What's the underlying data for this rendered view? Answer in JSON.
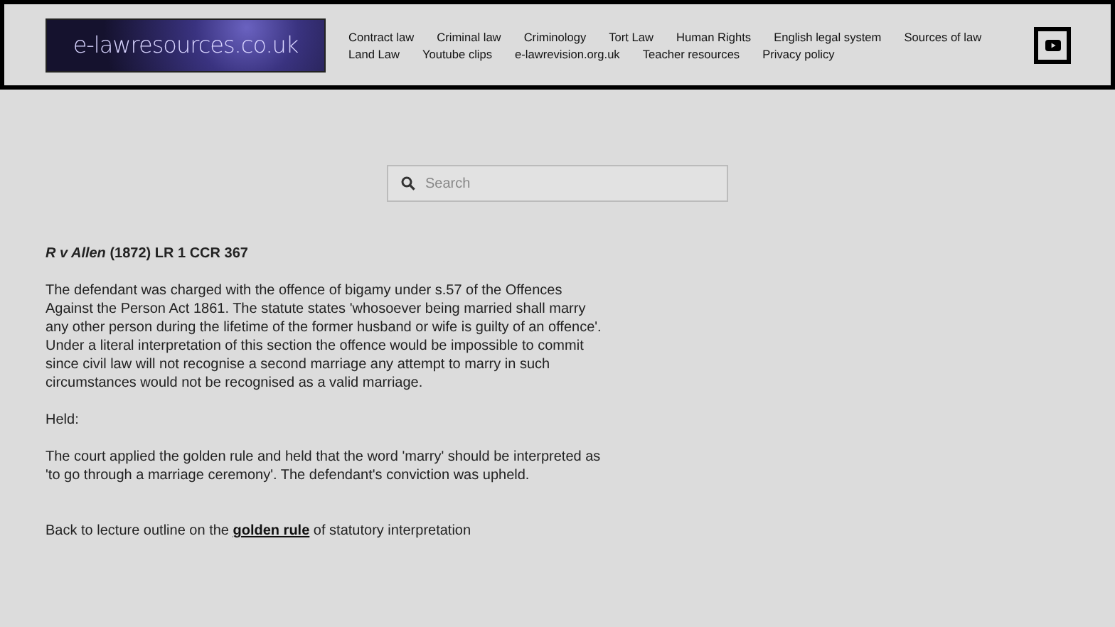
{
  "header": {
    "logo": "e-lawresources.co.uk",
    "nav_rows": [
      [
        "Contract law",
        "Criminal law",
        "Criminology",
        "Tort Law",
        "Human Rights",
        "English legal system",
        "Sources of law"
      ],
      [
        "Land Law",
        "Youtube clips",
        "e-lawrevision.org.uk",
        "Teacher resources",
        "Privacy policy"
      ]
    ]
  },
  "search": {
    "placeholder": "Search"
  },
  "article": {
    "title": "*R v Allen* (1872) LR 1 CCR 367",
    "paragraphs": [
      "The defendant was charged with the offence of bigamy under s.57 of the Offences Against the Person Act 1861. The statute states 'whosoever being married shall marry any other person during the lifetime of the former husband or wife is guilty of an offence'. Under a literal interpretation of this section the offence would be impossible to commit since civil law will not recognise a second marriage any attempt to marry in such circumstances would not be recognised as a valid marriage.",
      "Held:",
      "The court applied the golden rule and held that the word 'marry' should be interpreted as 'to go through a marriage ceremony'. The defendant's conviction was upheld."
    ],
    "back_link": {
      "before": "Back to lecture outline on the ",
      "link": "golden rule",
      "after": " of statutory interpretation"
    }
  }
}
